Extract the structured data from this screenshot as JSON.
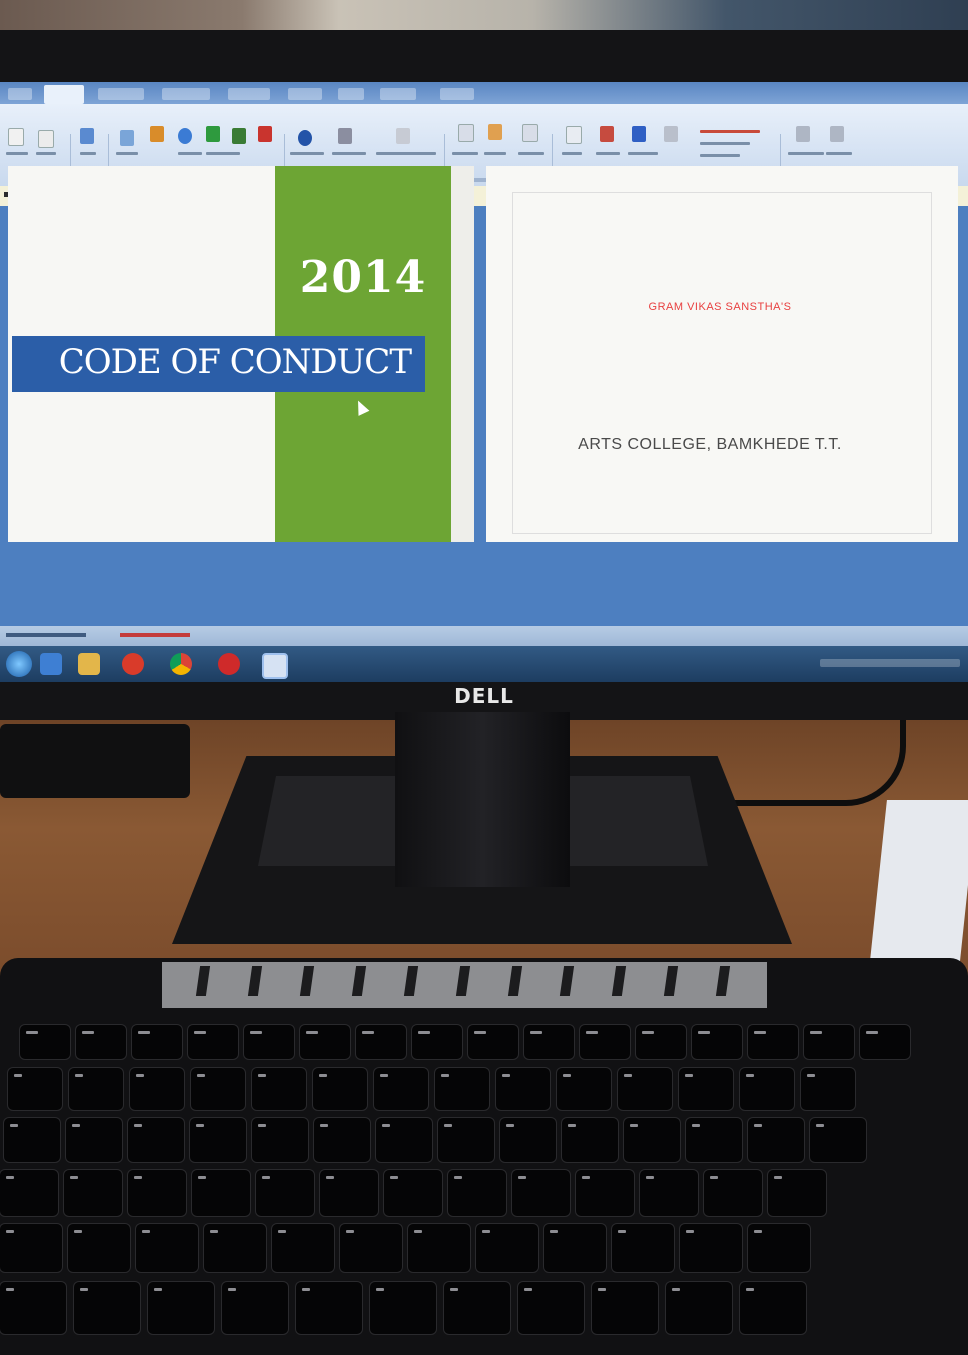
{
  "document": {
    "cover_year": "2014",
    "cover_title": "CODE OF CONDUCT",
    "society_name": "GRAM VIKAS SANSTHA'S",
    "college_name": "ARTS COLLEGE, BAMKHEDE T.T."
  },
  "monitor": {
    "brand": "DELL"
  },
  "colors": {
    "cover_green": "#6da534",
    "title_band_blue": "#2b5ea8",
    "society_red": "#e84040"
  }
}
